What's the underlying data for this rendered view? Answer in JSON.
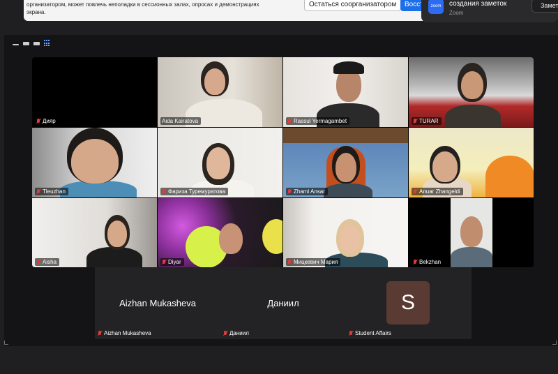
{
  "banner": {
    "message": "организатором, может повлечь неполадки в сессионных залах, опросах и демонстрациях экрана.",
    "stay_label": "Остаться соорганизатором",
    "restore_label": "Восстановить"
  },
  "toast": {
    "logo_text": "zoom",
    "title": "создания заметок",
    "source": "Zoom",
    "button_label": "Заметки"
  },
  "gallery": {
    "tiles": [
      {
        "name": "Дияр"
      },
      {
        "name": "Aida Kairatova"
      },
      {
        "name": "Rassul Yermagambet"
      },
      {
        "name": "TURAR"
      },
      {
        "name": "Tleuzhan"
      },
      {
        "name": "Фариза Туремуратова"
      },
      {
        "name": "Zhami Ansar"
      },
      {
        "name": "Anuar Zhangeldi"
      },
      {
        "name": "Aisha"
      },
      {
        "name": "Diyar"
      },
      {
        "name": "Мицкевич Мария"
      },
      {
        "name": "Bekzhan"
      }
    ]
  },
  "bottom": {
    "tiles": [
      {
        "display": "Aizhan Mukasheva",
        "name": "Aizhan Mukasheva"
      },
      {
        "display": "Даниил",
        "name": "Даниил"
      },
      {
        "avatar_letter": "S",
        "name": "Student Affairs"
      }
    ]
  },
  "colors": {
    "active_speaker": "#2fc52f",
    "muted_mic": "#e03c3c",
    "primary_button": "#1c6fe8",
    "avatar_bg": "#5a3b33"
  }
}
